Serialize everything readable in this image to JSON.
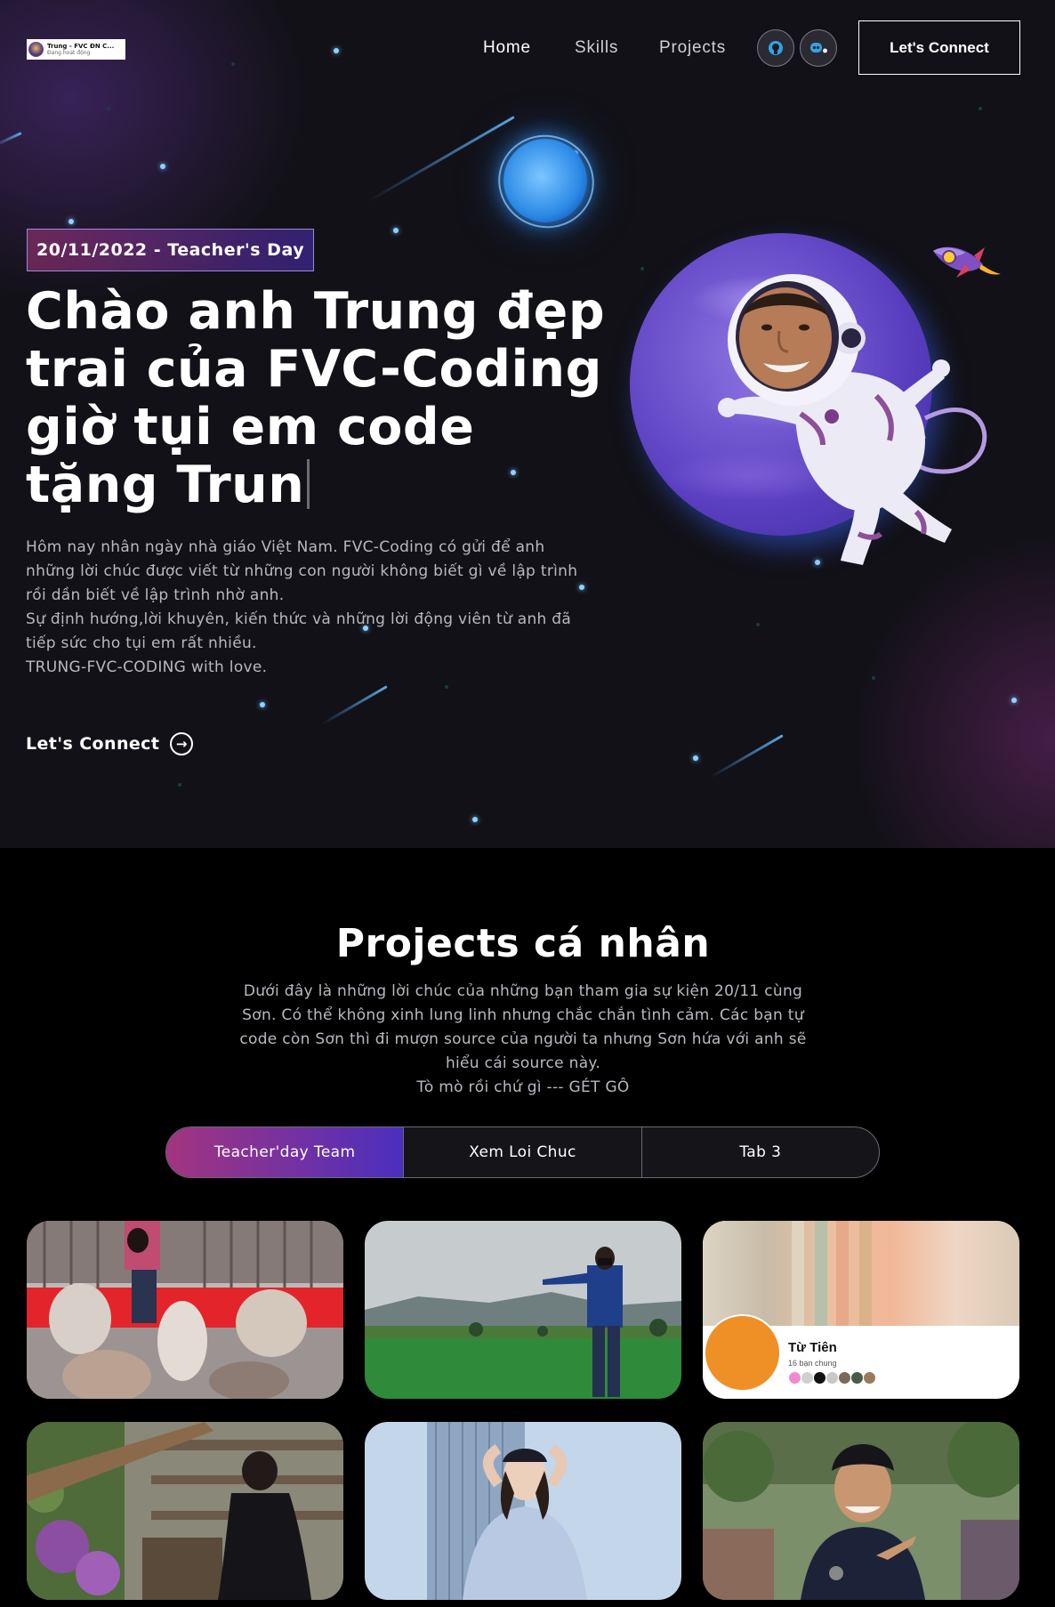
{
  "nav": {
    "logo": {
      "name": "Trung - FVC ĐN C...",
      "status": "Đang hoạt động"
    },
    "links": [
      "Home",
      "Skills",
      "Projects"
    ],
    "social_icons": [
      "github-icon",
      "discord-icon"
    ],
    "cta_label": "Let's Connect"
  },
  "hero": {
    "tagline": "20/11/2022 - Teacher's Day",
    "title": "Chào anh Trung đẹp trai của FVC-Coding giờ tụi em code tặng Trun",
    "description": "Hôm nay nhân ngày nhà giáo Việt Nam. FVC-Coding có gửi để anh những lời chúc được viết từ những con người không biết gì về lập trình rồi dần biết về lập trình nhờ anh.\nSự định hướng,lời khuyên, kiến thức và những lời động viên từ anh đã tiếp sức cho tụi em rất nhiều.\nTRUNG-FVC-CODING with love.",
    "cta_label": "Let's Connect",
    "cta_icon": "arrow-right-circle-icon"
  },
  "projects": {
    "title": "Projects cá nhân",
    "description": "Dưới đây là những lời chúc của những bạn tham gia sự kiện 20/11 cùng Sơn. Có thể không xinh lung linh nhưng chắc chắn tình cảm. Các bạn tự code còn Sơn thì đi mượn source của người ta nhưng Sơn hứa với anh sẽ hiểu cái source này.",
    "description_line2": "Tò mò rồi chứ gì --- GÉT GÔ",
    "tabs": [
      {
        "label": "Teacher'day Team",
        "active": true
      },
      {
        "label": "Xem Loi Chuc",
        "active": false
      },
      {
        "label": "Tab 3",
        "active": false
      }
    ],
    "profile_card": {
      "name": "Từ Tiên",
      "mutual": "16 bạn chung"
    }
  },
  "colors": {
    "accent_pink": "#a3347f",
    "accent_purple": "#4b2fbf",
    "background": "#121117",
    "star_blue": "#8fd2ff"
  }
}
